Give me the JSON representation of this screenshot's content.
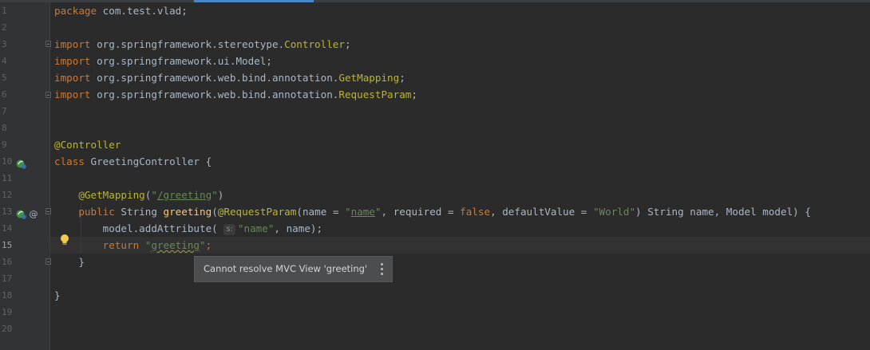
{
  "editor": {
    "current_line": 15,
    "line_numbers": [
      "1",
      "2",
      "3",
      "4",
      "5",
      "6",
      "7",
      "8",
      "9",
      "10",
      "11",
      "12",
      "13",
      "14",
      "15",
      "16",
      "17",
      "18",
      "19",
      "20"
    ],
    "lines": {
      "l1": {
        "kw": "package",
        "rest": " com.test.vlad;"
      },
      "l3": {
        "kw": "import",
        "pkg": " org.springframework.stereotype.",
        "cls": "Controller",
        "end": ";"
      },
      "l4": {
        "kw": "import",
        "rest": " org.springframework.ui.Model;"
      },
      "l5": {
        "kw": "import",
        "pkg": " org.springframework.web.bind.annotation.",
        "cls": "GetMapping",
        "end": ";"
      },
      "l6": {
        "kw": "import",
        "pkg": " org.springframework.web.bind.annotation.",
        "cls": "RequestParam",
        "end": ";"
      },
      "l9": {
        "ann": "@Controller"
      },
      "l10": {
        "kw": "class",
        "rest": " GreetingController {"
      },
      "l12": {
        "indent": "    ",
        "ann": "@GetMapping",
        "open": "(",
        "q1": "\"",
        "path": "/greeting",
        "q2": "\"",
        "close": ")"
      },
      "l13": {
        "indent": "    ",
        "kw": "public",
        "p1": " String ",
        "name": "greeting",
        "p2": "(",
        "ann": "@RequestParam",
        "p3": "(name = ",
        "q1": "\"",
        "v1": "name",
        "q2": "\"",
        "p4": ", required = ",
        "kw2": "false",
        "p5": ", defaultValue = ",
        "s2": "\"World\"",
        "p6": ") String name, Model model) {"
      },
      "l14": {
        "indent": "        ",
        "pre": "model.addAttribute( ",
        "hint": "s:",
        "str": "\"name\"",
        "post": ", name);"
      },
      "l15": {
        "indent": "        ",
        "kw": "return",
        "sp": " ",
        "q1": "\"",
        "val": "greeting",
        "q2": "\"",
        "end": ";"
      },
      "l16": {
        "indent": "    ",
        "text": "}"
      },
      "l18": {
        "text": "}"
      }
    }
  },
  "tooltip": {
    "message": "Cannot resolve MVC View 'greeting'",
    "more_icon": "vertical-ellipsis-icon"
  },
  "icons": {
    "line10": "spring-bean-icon",
    "line13": [
      "spring-bean-icon",
      "at-mapping-icon"
    ],
    "line15": "lightbulb-icon"
  },
  "colors": {
    "background": "#2b2b2b",
    "gutter": "#313335",
    "keyword": "#cc7832",
    "annotation": "#bbb529",
    "string": "#6a8759",
    "text": "#a9b7c6"
  },
  "gutter_marks": {
    "at_symbol": "@"
  }
}
